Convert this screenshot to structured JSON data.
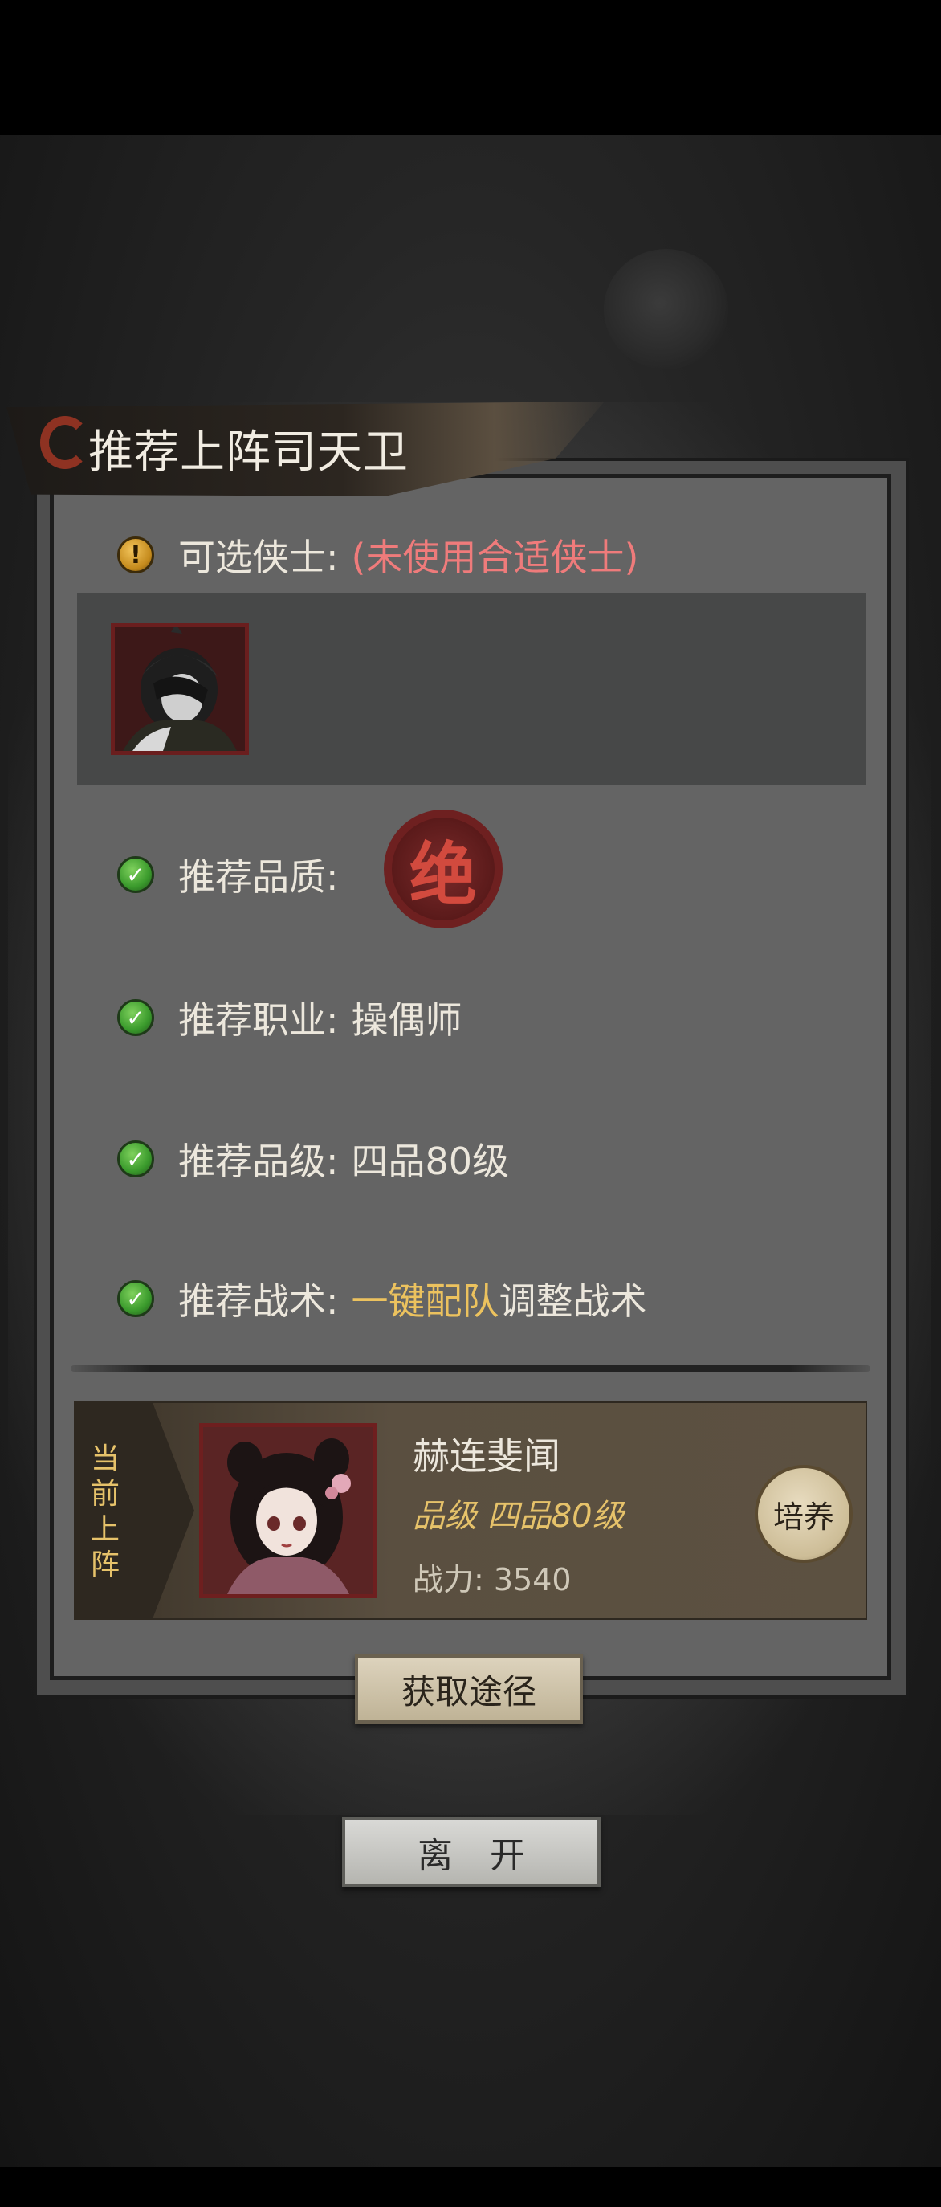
{
  "dialog": {
    "title": "推荐上阵司天卫",
    "available_label": "可选侠士:",
    "available_value": "(未使用合适侠士)",
    "quality_label": "推荐品质:",
    "quality_seal": "绝",
    "profession_label": "推荐职业:",
    "profession_value": "操偶师",
    "rank_label": "推荐品级:",
    "rank_value": "四品80级",
    "tactic_label": "推荐战术:",
    "tactic_link": "一键配队",
    "tactic_suffix": "调整战术"
  },
  "current": {
    "tag": "当前上阵",
    "name": "赫连斐闻",
    "rank": "品级 四品80级",
    "power": "战力: 3540",
    "train_label": "培养"
  },
  "buttons": {
    "obtain_label": "获取途径",
    "leave_label": "离开"
  },
  "icons": {
    "warn": "warning-icon",
    "check": "check-icon"
  }
}
